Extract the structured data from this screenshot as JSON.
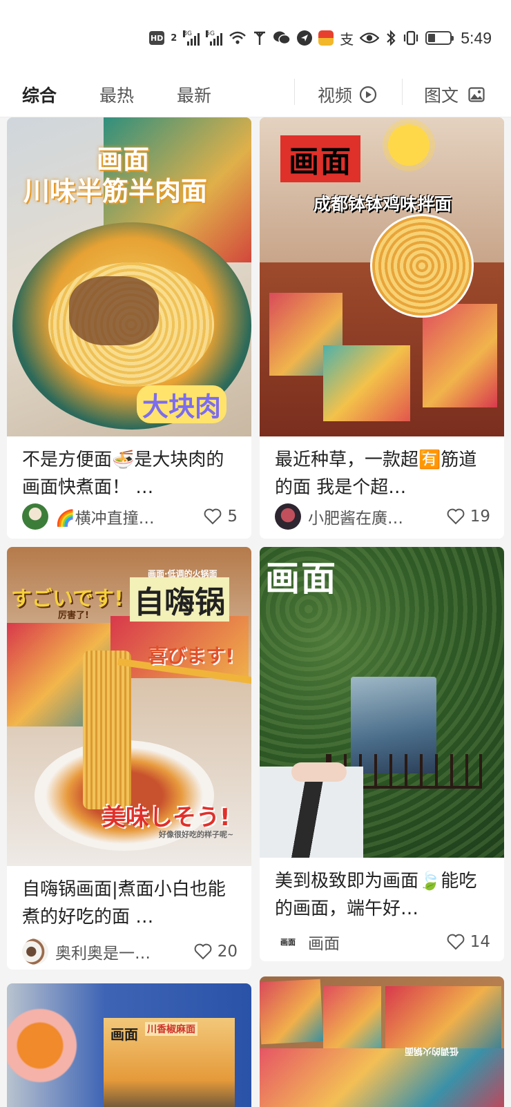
{
  "status_bar": {
    "hd_label": "HD",
    "sim_label": "2",
    "net1": "3G",
    "net2": "5G",
    "pay_glyph": "支",
    "time": "5:49",
    "icons": [
      "hd-icon",
      "signal-3g-icon",
      "signal-5g-icon",
      "wifi-icon",
      "antenna-icon",
      "wechat-icon",
      "location-icon",
      "app-notification-icon",
      "alipay-icon",
      "eye-icon",
      "bluetooth-icon",
      "vibrate-icon",
      "battery-icon"
    ]
  },
  "tabs": {
    "t1": "综合",
    "t2": "最热",
    "t3": "最新",
    "t4": "视频",
    "t5": "图文",
    "active": "综合"
  },
  "cards": {
    "c1": {
      "overlay_brand": "画面",
      "overlay_title": "川味半筋半肉面",
      "overlay_tag": "大块肉",
      "title": "不是方便面🍜是大块肉的画面快煮面！ …",
      "author": "🌈横冲直撞…",
      "likes": "5"
    },
    "c2": {
      "overlay_brand": "画面",
      "overlay_title": "成都钵钵鸡味拌面",
      "title": "最近种草，一款超🈶筋道的面 我是个超…",
      "author": "小肥酱在廣…",
      "likes": "19"
    },
    "c3": {
      "overlay_small": "画面·低调的火锅面",
      "overlay_jp1": "すごいです!",
      "overlay_jp1_sub": "厉害了!",
      "overlay_cn": "自嗨锅",
      "overlay_jp2": "喜びます!",
      "overlay_jp3": "美味しそう!",
      "overlay_caption": "好像很好吃的样子呢~",
      "title": "自嗨锅画面|煮面小白也能煮的好吃的面 …",
      "author": "奥利奥是一…",
      "likes": "20"
    },
    "c4": {
      "overlay_brand": "画面",
      "title": "美到极致即为画面🍃能吃的画面，端午好…",
      "author": "画面",
      "author_logo": "画面",
      "likes": "14"
    },
    "c5": {
      "overlay_brand": "画面",
      "overlay_title": "川香椒麻面"
    },
    "c6": {
      "overlay_text": "低调的火锅面"
    }
  },
  "colors": {
    "accent_red": "#e0302a",
    "overlay_yellow": "#ffd34a",
    "text_primary": "#222222",
    "text_secondary": "#555555"
  }
}
